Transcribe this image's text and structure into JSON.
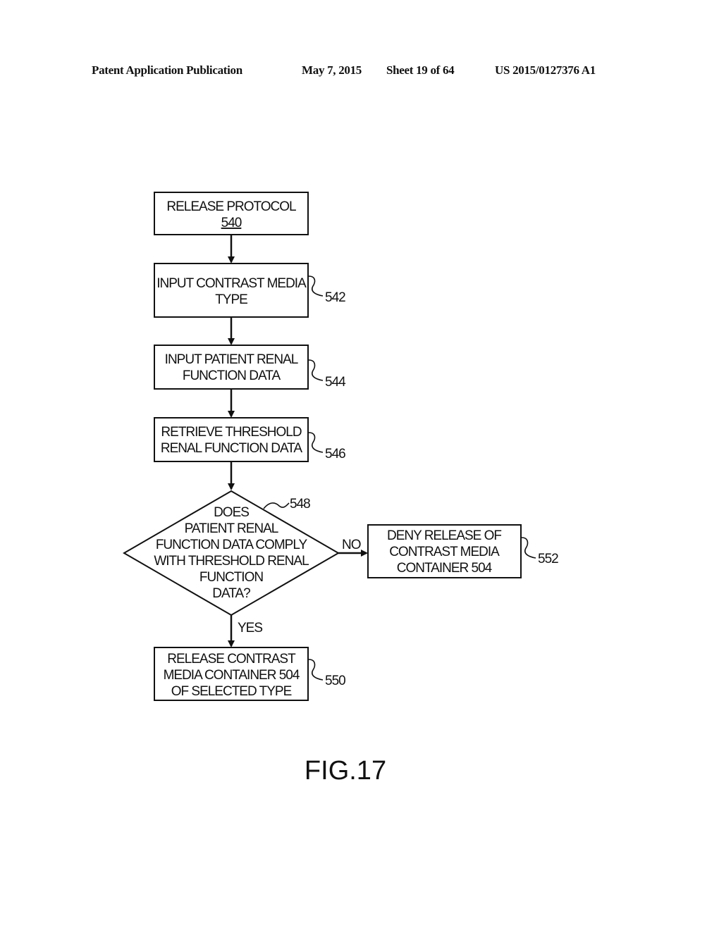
{
  "header": {
    "publication": "Patent Application Publication",
    "date": "May 7, 2015",
    "sheet": "Sheet 19 of 64",
    "number": "US 2015/0127376 A1"
  },
  "flowchart": {
    "start": {
      "line1": "RELEASE PROTOCOL",
      "ref": "540"
    },
    "step542": {
      "line1": "INPUT CONTRAST MEDIA",
      "line2": "TYPE",
      "ref": "542"
    },
    "step544": {
      "line1": "INPUT PATIENT RENAL",
      "line2": "FUNCTION DATA",
      "ref": "544"
    },
    "step546": {
      "line1": "RETRIEVE THRESHOLD",
      "line2": "RENAL FUNCTION DATA",
      "ref": "546"
    },
    "decision548": {
      "lines": [
        "DOES",
        "PATIENT RENAL",
        "FUNCTION DATA COMPLY",
        "WITH THRESHOLD RENAL",
        "FUNCTION",
        "DATA?"
      ],
      "ref": "548",
      "no_label": "NO",
      "yes_label": "YES"
    },
    "step552": {
      "line1": "DENY RELEASE OF",
      "line2": "CONTRAST MEDIA",
      "line3": "CONTAINER 504",
      "ref": "552"
    },
    "step550": {
      "line1": "RELEASE CONTRAST",
      "line2": "MEDIA CONTAINER 504",
      "line3": "OF SELECTED TYPE",
      "ref": "550"
    }
  },
  "figure_label": "FIG.17"
}
